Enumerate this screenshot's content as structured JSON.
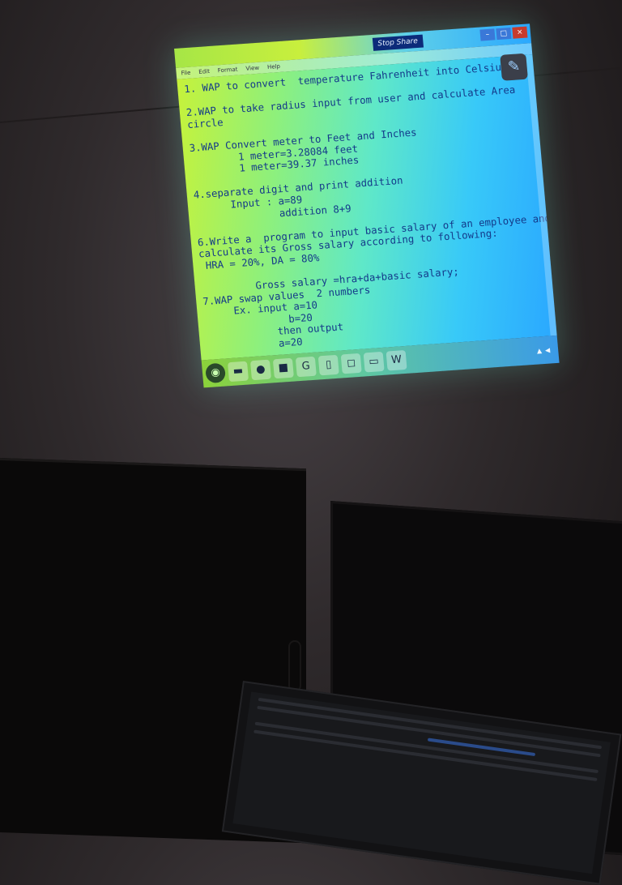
{
  "window": {
    "stop_share_label": "Stop Share",
    "menu": [
      "File",
      "Edit",
      "Format",
      "View",
      "Help"
    ]
  },
  "editor": {
    "lines": [
      "1. WAP to convert  temperature Fahrenheit into Celsius",
      "",
      "2.WAP to take radius input from user and calculate Area",
      "circle",
      "",
      "3.WAP Convert meter to Feet and Inches",
      "        1 meter=3.28084 feet",
      "        1 meter=39.37 inches",
      "",
      "4.separate digit and print addition",
      "      Input : a=89",
      "              addition 8+9",
      "",
      "6.Write a  program to input basic salary of an employee and",
      "calculate its Gross salary according to following:",
      " HRA = 20%, DA = 80%",
      "",
      "         Gross salary =hra+da+basic salary;",
      "7.WAP swap values  2 numbers",
      "     Ex. input a=10",
      "              b=20",
      "            then output",
      "            a=20"
    ]
  },
  "taskbar": {
    "items": [
      {
        "name": "start-button",
        "icon": "windows-orb-icon",
        "glyph": "◉"
      },
      {
        "name": "file-explorer",
        "icon": "folder-icon",
        "glyph": "▬"
      },
      {
        "name": "chrome",
        "icon": "chrome-icon",
        "glyph": "●"
      },
      {
        "name": "zoom",
        "icon": "zoom-icon",
        "glyph": "■"
      },
      {
        "name": "app-g",
        "icon": "g-app-icon",
        "glyph": "G"
      },
      {
        "name": "app-doc",
        "icon": "document-icon",
        "glyph": "▯"
      },
      {
        "name": "app-chat",
        "icon": "chat-icon",
        "glyph": "◻"
      },
      {
        "name": "app-notepad",
        "icon": "notepad-icon",
        "glyph": "▭"
      },
      {
        "name": "app-word",
        "icon": "word-icon",
        "glyph": "W"
      }
    ]
  }
}
